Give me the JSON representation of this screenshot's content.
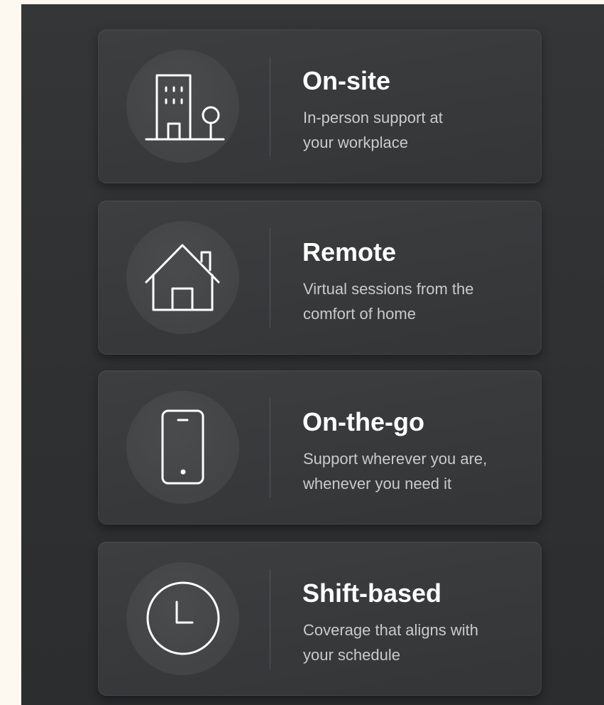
{
  "colors": {
    "page_background": "#fdf8f0",
    "panel_background": "#303132",
    "card_background": "#3a3b3d",
    "icon_circle": "#464749",
    "title": "#ffffff",
    "description": "#c9cacb",
    "icon_stroke": "#ffffff"
  },
  "options": [
    {
      "title": "On-site",
      "description_lines": [
        "In-person support at",
        "your workplace"
      ],
      "icon": "office-building-icon"
    },
    {
      "title": "Remote",
      "description_lines": [
        "Virtual sessions from the",
        "comfort of home"
      ],
      "icon": "house-icon"
    },
    {
      "title": "On-the-go",
      "description_lines": [
        "Support wherever you are,",
        "whenever you need it"
      ],
      "icon": "smartphone-icon"
    },
    {
      "title": "Shift-based",
      "description_lines": [
        "Coverage that aligns with",
        "your schedule"
      ],
      "icon": "clock-icon"
    }
  ]
}
